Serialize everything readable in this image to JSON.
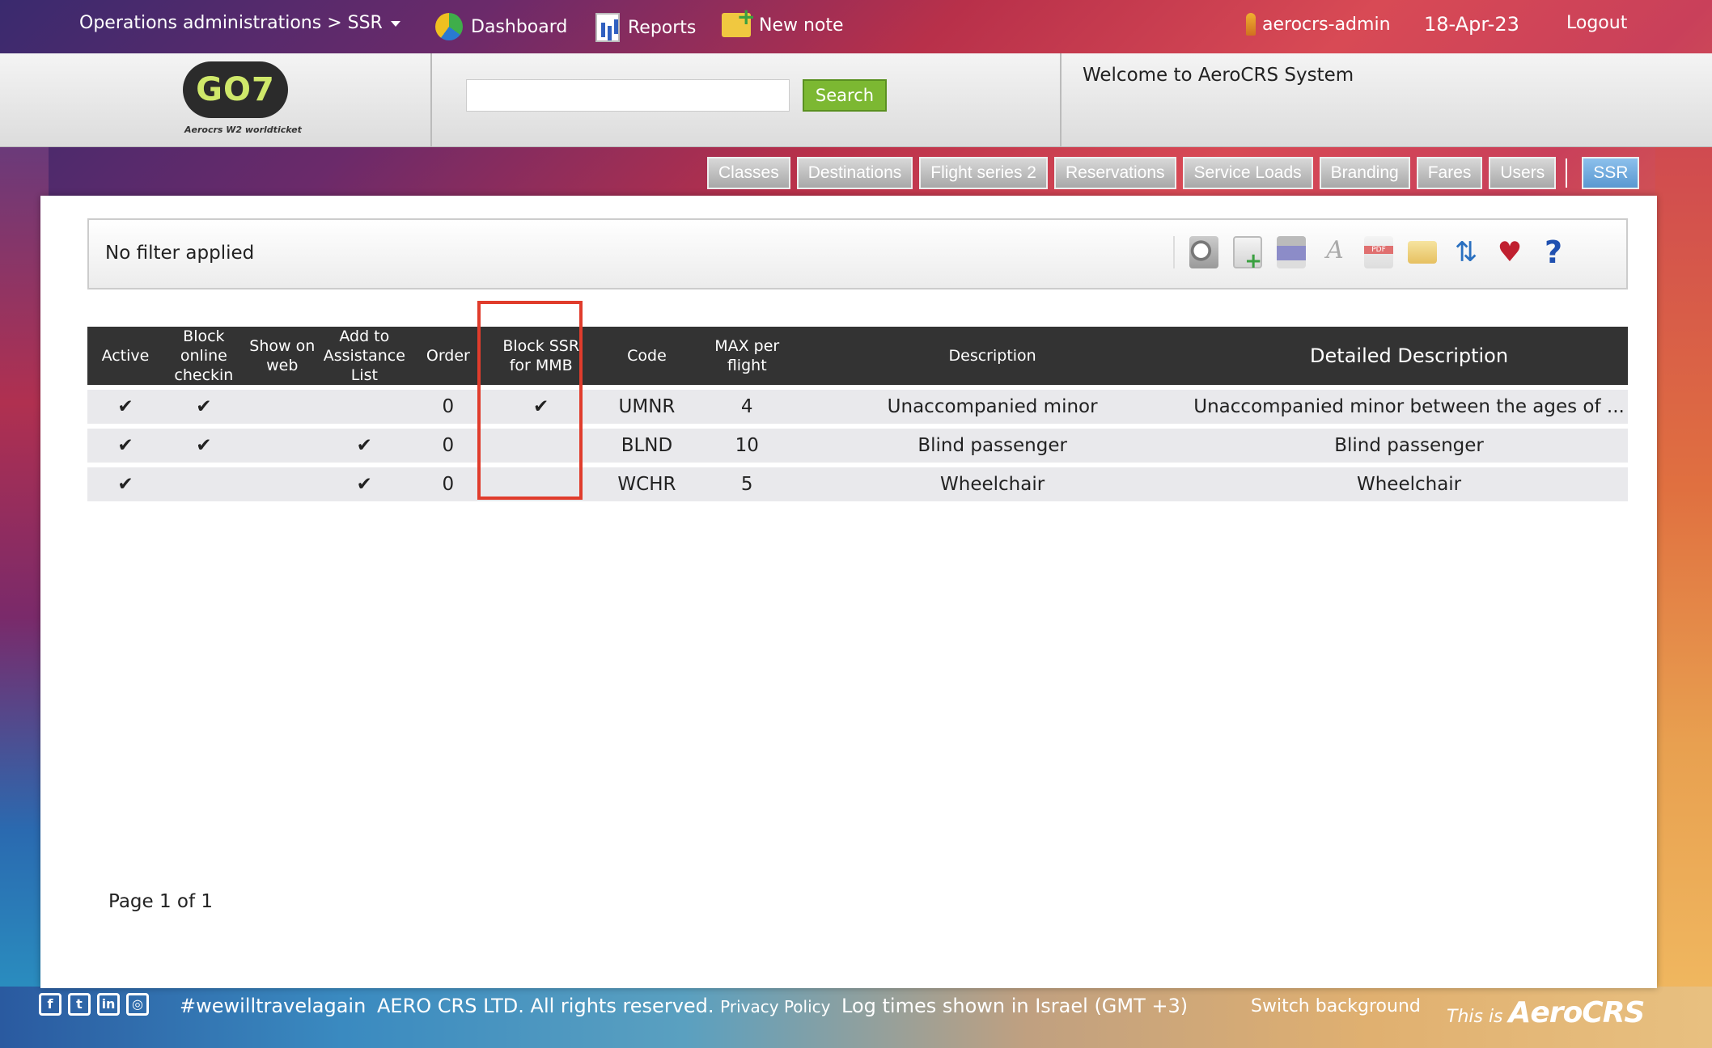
{
  "topbar": {
    "breadcrumb": "Operations administrations > SSR",
    "dashboard": "Dashboard",
    "reports": "Reports",
    "new_note": "New note",
    "user": "aerocrs-admin",
    "date": "18-Apr-23",
    "logout": "Logout"
  },
  "header": {
    "logo_text": "GO7",
    "logo_sub": "Aerocrs W2 worldticket",
    "search_placeholder": "",
    "search_button": "Search",
    "welcome": "Welcome to AeroCRS System"
  },
  "tabs": [
    "Classes",
    "Destinations",
    "Flight series 2",
    "Reservations",
    "Service Loads",
    "Branding",
    "Fares",
    "Users",
    "SSR"
  ],
  "active_tab": "SSR",
  "filter": {
    "text": "No filter applied"
  },
  "toolbar_icons": [
    "search-icon",
    "add-document-icon",
    "print-icon",
    "font-icon",
    "pdf-icon",
    "mail-icon",
    "sync-icon",
    "heart-icon",
    "help-icon"
  ],
  "table": {
    "headers": {
      "active": "Active",
      "block_online": "Block online checkin",
      "show_web": "Show on web",
      "assistance": "Add to Assistance List",
      "order": "Order",
      "block_mmb": "Block SSR for MMB",
      "code": "Code",
      "max": "MAX per flight",
      "description": "Description",
      "detailed": "Detailed Description"
    },
    "rows": [
      {
        "active": "✔",
        "block_online": "✔",
        "show_web": "",
        "assistance": "",
        "order": "0",
        "block_mmb": "✔",
        "code": "UMNR",
        "max": "4",
        "description": "Unaccompanied minor",
        "detailed": "Unaccompanied minor between the ages of ..."
      },
      {
        "active": "✔",
        "block_online": "✔",
        "show_web": "",
        "assistance": "✔",
        "order": "0",
        "block_mmb": "",
        "code": "BLND",
        "max": "10",
        "description": "Blind passenger",
        "detailed": "Blind passenger"
      },
      {
        "active": "✔",
        "block_online": "",
        "show_web": "",
        "assistance": "✔",
        "order": "0",
        "block_mmb": "",
        "code": "WCHR",
        "max": "5",
        "description": "Wheelchair",
        "detailed": "Wheelchair"
      }
    ]
  },
  "pager": "Page 1 of 1",
  "footer": {
    "hashtag": "#wewilltravelagain",
    "copyright": "AERO CRS LTD. All rights reserved.",
    "privacy": "Privacy Policy",
    "log_times": "Log times shown in Israel (GMT +3)",
    "switch_bg": "Switch background",
    "brand_prefix": "This is",
    "brand": "AeroCRS"
  },
  "colors": {
    "accent": "#7cb832",
    "active_tab": "#5a98d0",
    "highlight": "#e03c2c",
    "header_row": "#333333"
  }
}
